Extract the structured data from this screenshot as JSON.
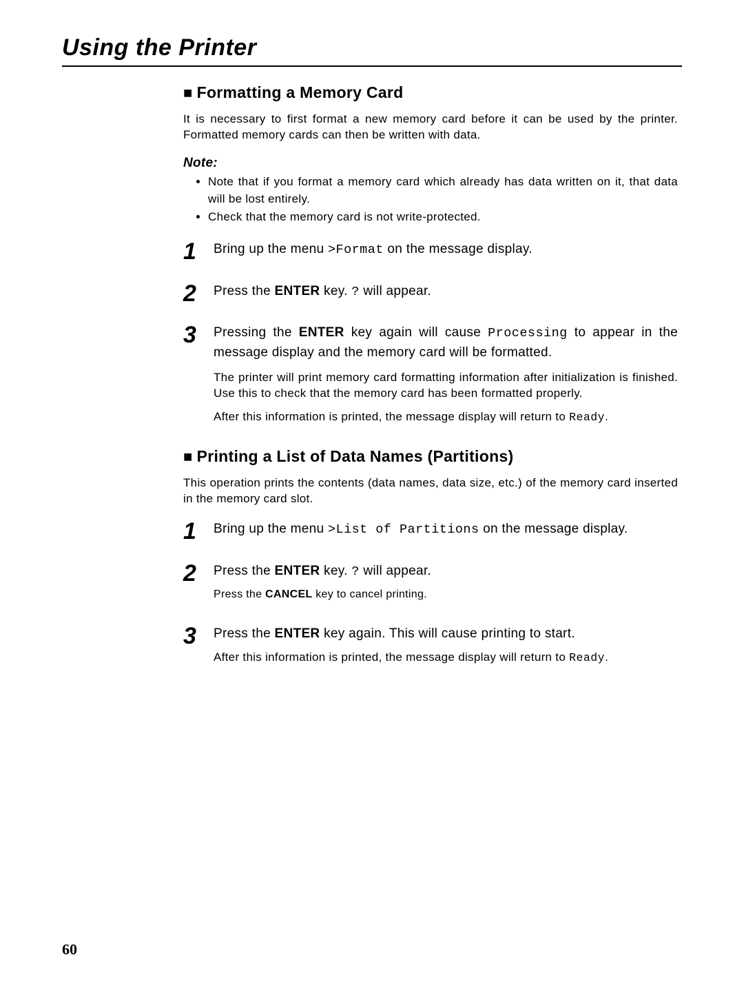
{
  "chapterTitle": "Using the Printer",
  "pageNumber": "60",
  "section1": {
    "heading": "Formatting a Memory Card",
    "intro": "It is necessary to first format a new memory card before it can be used by the printer. Formatted memory cards can then be written with data.",
    "noteLabel": "Note:",
    "noteItems": [
      "Note that if you format a memory card which already has data written on it, that data will be lost entirely.",
      "Check that the memory card is not write-protected."
    ],
    "steps": [
      {
        "num": "1",
        "main_pre": "Bring up the menu ",
        "main_mono": ">Format",
        "main_post": " on the message display."
      },
      {
        "num": "2",
        "main_pre": "Press the ",
        "main_bold": "ENTER",
        "main_mid": " key. ",
        "main_mono": "?",
        "main_post": " will appear."
      },
      {
        "num": "3",
        "main_pre": "Pressing the ",
        "main_bold": "ENTER",
        "main_mid": " key again will cause ",
        "main_mono": "Processing",
        "main_post": " to appear in the message display and the memory card will be formatted.",
        "sub1": "The printer will print memory card formatting information after initialization is finished.  Use this to check that the memory card has been formatted properly.",
        "sub2_pre": "After this information is printed, the message display will return to ",
        "sub2_mono": "Ready",
        "sub2_post": "."
      }
    ]
  },
  "section2": {
    "heading": "Printing a List of Data Names (Partitions)",
    "intro": "This operation prints the contents (data names, data size, etc.) of the memory card inserted in the memory card slot.",
    "steps": [
      {
        "num": "1",
        "main_pre": "Bring up the menu ",
        "main_mono": ">List of Partitions",
        "main_post": " on the message display."
      },
      {
        "num": "2",
        "main_pre": "Press the ",
        "main_bold": "ENTER",
        "main_mid": " key. ",
        "main_mono": "?",
        "main_post": " will appear.",
        "sub_pre": " Press the ",
        "sub_bold": "CANCEL",
        "sub_post": " key to cancel printing."
      },
      {
        "num": "3",
        "main_pre": "Press the ",
        "main_bold": "ENTER",
        "main_post": " key again. This will cause printing to start.",
        "sub_pre": "After this information is printed, the message display will return to ",
        "sub_mono": "Ready",
        "sub_post": "."
      }
    ]
  }
}
